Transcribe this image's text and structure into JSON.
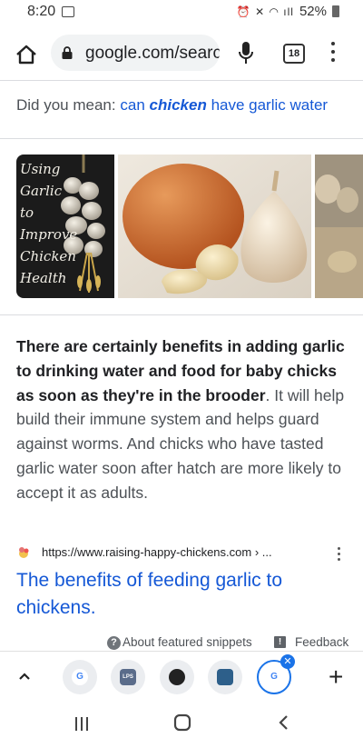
{
  "status": {
    "time": "8:20",
    "battery": "52%"
  },
  "toolbar": {
    "url": "google.com/search",
    "tab_count": "18"
  },
  "did_you_mean": {
    "prefix": "Did you mean:",
    "link_pre": "can",
    "link_bold": "chicken",
    "link_post": "have garlic water"
  },
  "images": {
    "card1_lines": [
      "Using",
      "Garlic",
      "to",
      "Improve",
      "Chicken",
      "Health"
    ]
  },
  "snippet": {
    "bold": "There are certainly benefits in adding garlic to drinking water and food for baby chicks as soon as they're in the brooder",
    "rest": ". It will help build their immune system and helps guard against worms. And chicks who have tasted garlic water soon after hatch are more likely to accept it as adults."
  },
  "source": {
    "url": "https://www.raising-happy-chickens.com › ..."
  },
  "result": {
    "title": "The benefits of feeding garlic to chickens."
  },
  "footer": {
    "about": "About featured snippets",
    "feedback": "Feedback"
  },
  "tabstrip": {
    "tab1": "G",
    "tab2": "LPS",
    "tab5": "G"
  },
  "icons": [
    "home-icon",
    "lock-icon",
    "mic-icon",
    "tab-switcher-icon",
    "kebab-menu-icon",
    "chevron-up-icon",
    "plus-icon",
    "recents-icon",
    "home-nav-icon",
    "back-icon"
  ]
}
